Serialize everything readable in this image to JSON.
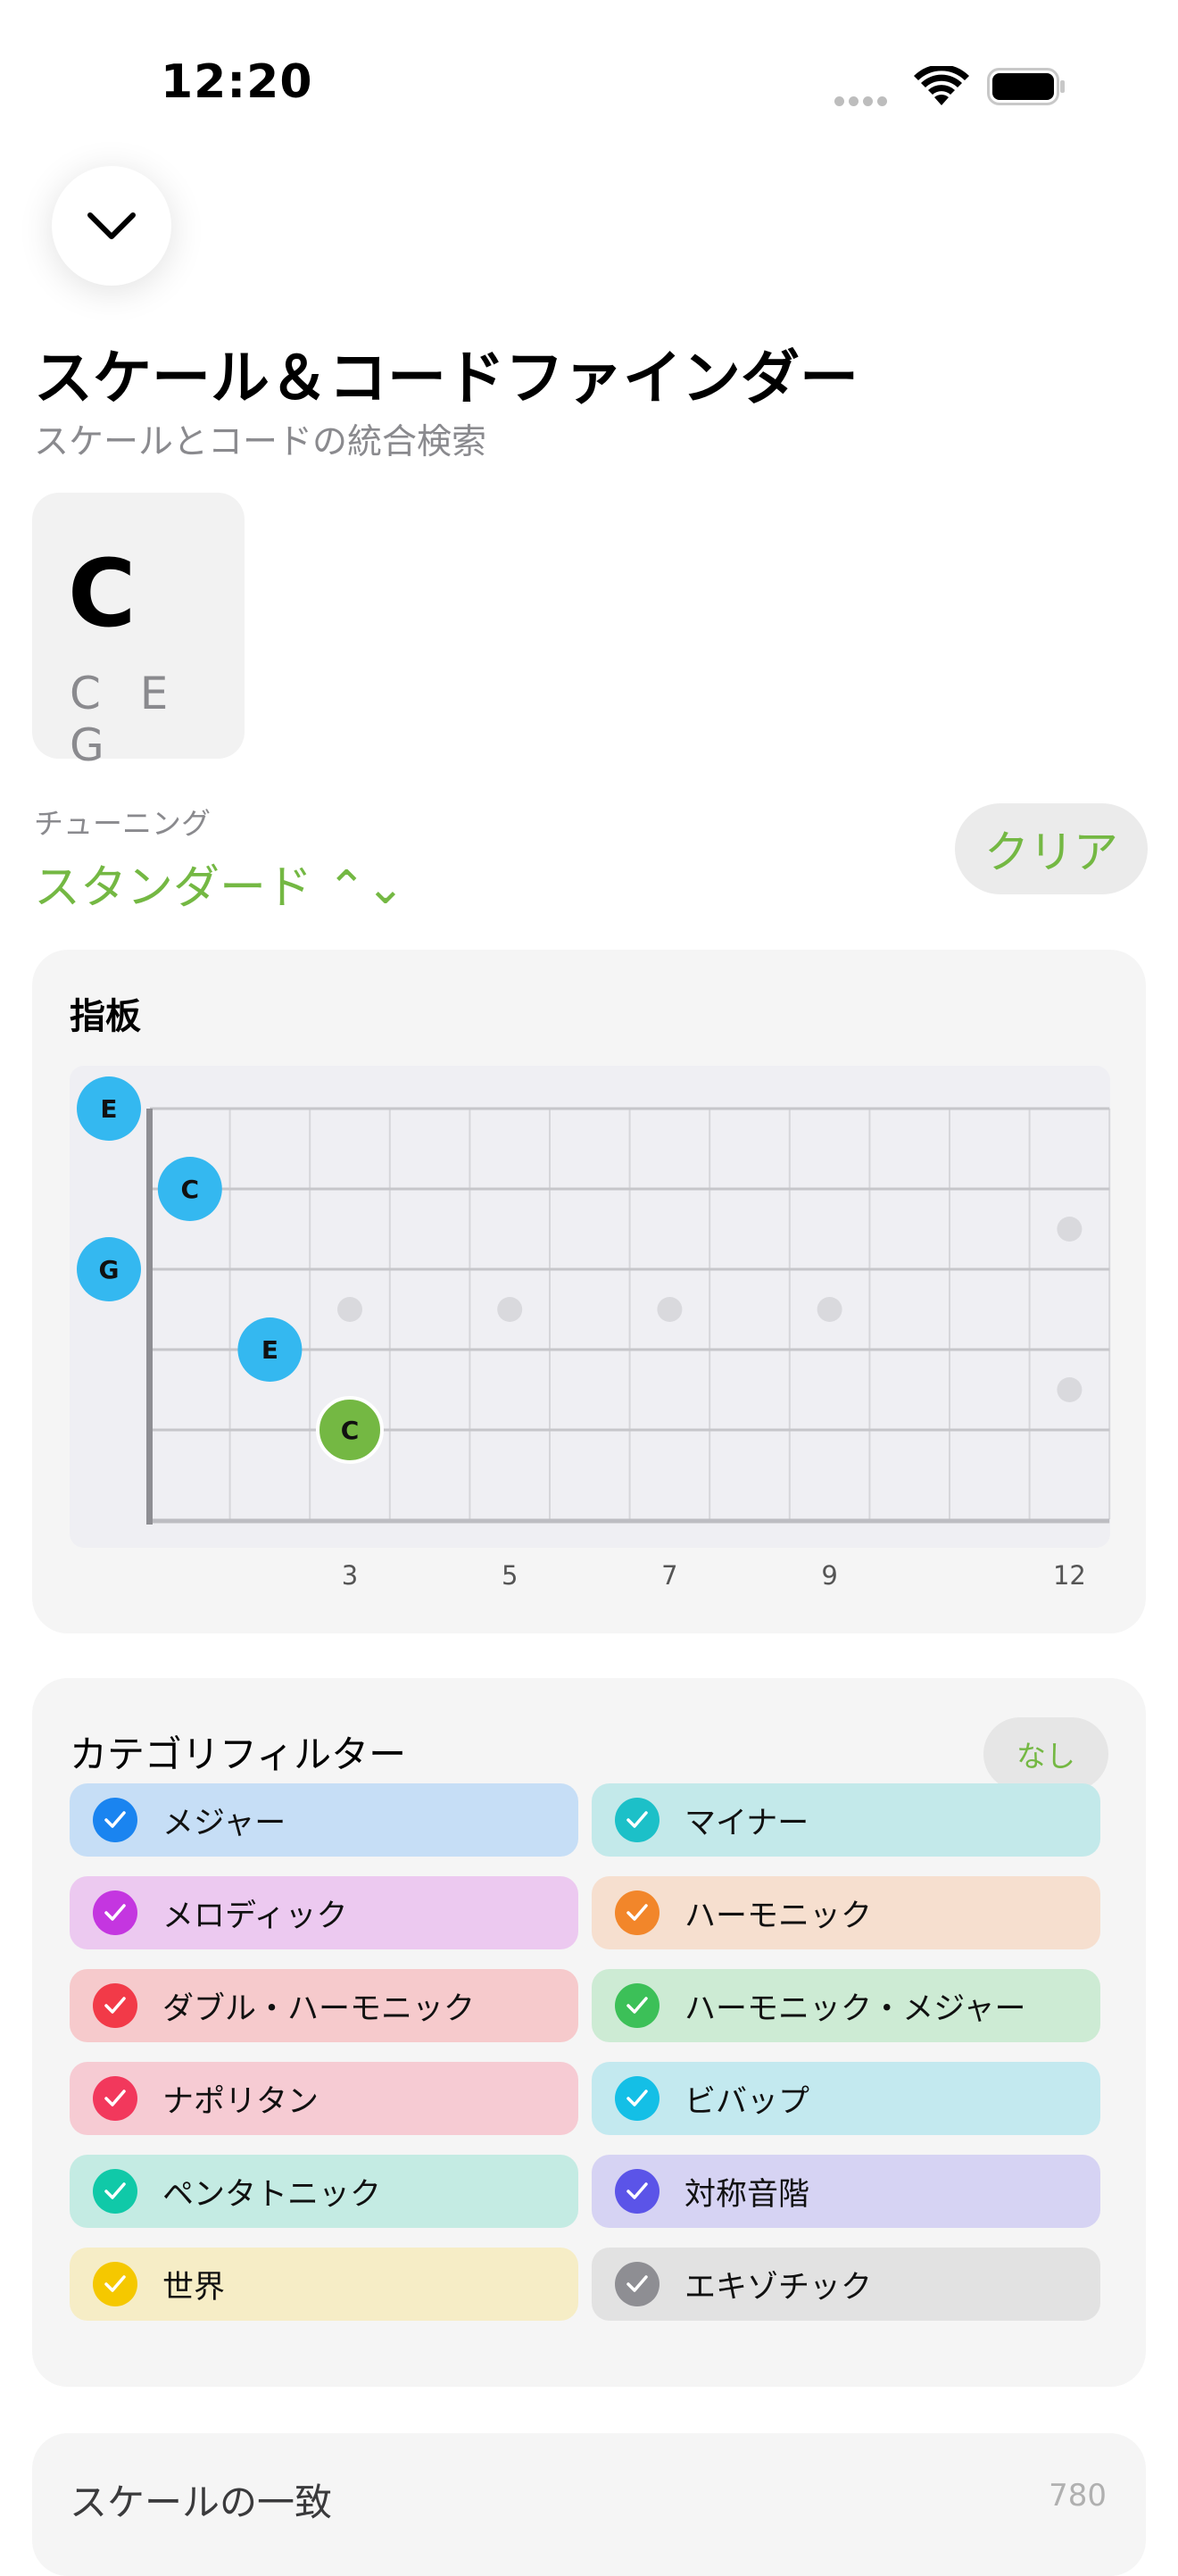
{
  "status": {
    "time": "12:20"
  },
  "header": {
    "title": "スケール＆コードファインダー",
    "subtitle": "スケールとコードの統合検索"
  },
  "chord": {
    "name": "C",
    "notes": "C E G"
  },
  "tuning": {
    "label": "チューニング",
    "value": "スタンダード ⌃⌄",
    "clear_label": "クリア"
  },
  "fretboard": {
    "title": "指板",
    "fret_markers": [
      "3",
      "5",
      "7",
      "9",
      "12"
    ],
    "notes": [
      {
        "string": 1,
        "fret": 0,
        "note": "E",
        "root": false
      },
      {
        "string": 2,
        "fret": 1,
        "note": "C",
        "root": false
      },
      {
        "string": 3,
        "fret": 0,
        "note": "G",
        "root": false
      },
      {
        "string": 4,
        "fret": 2,
        "note": "E",
        "root": false
      },
      {
        "string": 5,
        "fret": 3,
        "note": "C",
        "root": true
      }
    ],
    "colors": {
      "note": "#34b8f0",
      "root": "#74b843"
    }
  },
  "filters": {
    "title": "カテゴリフィルター",
    "none_label": "なし",
    "items": [
      {
        "label": "メジャー",
        "checked": true,
        "color": "#1a84f0",
        "bg": "#c6def6"
      },
      {
        "label": "マイナー",
        "checked": true,
        "color": "#1cc0c8",
        "bg": "#c3e9ea"
      },
      {
        "label": "メロディック",
        "checked": true,
        "color": "#c436e0",
        "bg": "#ecc9f0"
      },
      {
        "label": "ハーモニック",
        "checked": true,
        "color": "#f2862a",
        "bg": "#f6dfcf"
      },
      {
        "label": "ダブル・ハーモニック",
        "checked": true,
        "color": "#f23a48",
        "bg": "#f6cacc"
      },
      {
        "label": "ハーモニック・メジャー",
        "checked": true,
        "color": "#3cc058",
        "bg": "#cdebd4"
      },
      {
        "label": "ナポリタン",
        "checked": true,
        "color": "#f2385c",
        "bg": "#f6cbd3"
      },
      {
        "label": "ビバップ",
        "checked": true,
        "color": "#14bfe6",
        "bg": "#c3e9ef"
      },
      {
        "label": "ペンタトニック",
        "checked": true,
        "color": "#10c9a8",
        "bg": "#c4ebe3"
      },
      {
        "label": "対称音階",
        "checked": true,
        "color": "#5b54e8",
        "bg": "#d6d3f3"
      },
      {
        "label": "世界",
        "checked": true,
        "color": "#f5c800",
        "bg": "#f6edc6"
      },
      {
        "label": "エキゾチック",
        "checked": true,
        "color": "#8e8e93",
        "bg": "#e2e2e2"
      }
    ]
  },
  "matches": {
    "label": "スケールの一致",
    "count": "780"
  }
}
